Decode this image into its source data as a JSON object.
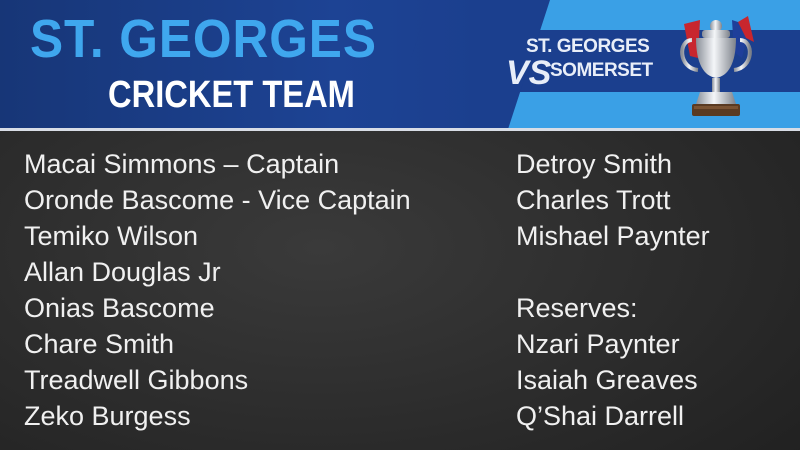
{
  "header": {
    "title": "ST. GEORGES",
    "subtitle": "CRICKET TEAM",
    "matchup": {
      "team_a": "ST. GEORGES",
      "vs": "VS",
      "team_b": "SOMERSET"
    },
    "colors": {
      "primary_blue": "#1b3f8e",
      "accent_blue": "#3aa0e6",
      "title_blue": "#3fa7ee"
    }
  },
  "roster": {
    "left": [
      "Macai Simmons – Captain",
      "Oronde Bascome - Vice Captain",
      "Temiko Wilson",
      "Allan Douglas Jr",
      "Onias Bascome",
      "Chare Smith",
      "Treadwell Gibbons",
      "Zeko Burgess"
    ],
    "right": [
      "Detroy Smith",
      "Charles Trott",
      "Mishael Paynter"
    ],
    "reserves_label": "Reserves:",
    "reserves": [
      "Nzari Paynter",
      "Isaiah Greaves",
      "Q’Shai Darrell"
    ]
  },
  "icons": [
    "trophy-icon"
  ]
}
